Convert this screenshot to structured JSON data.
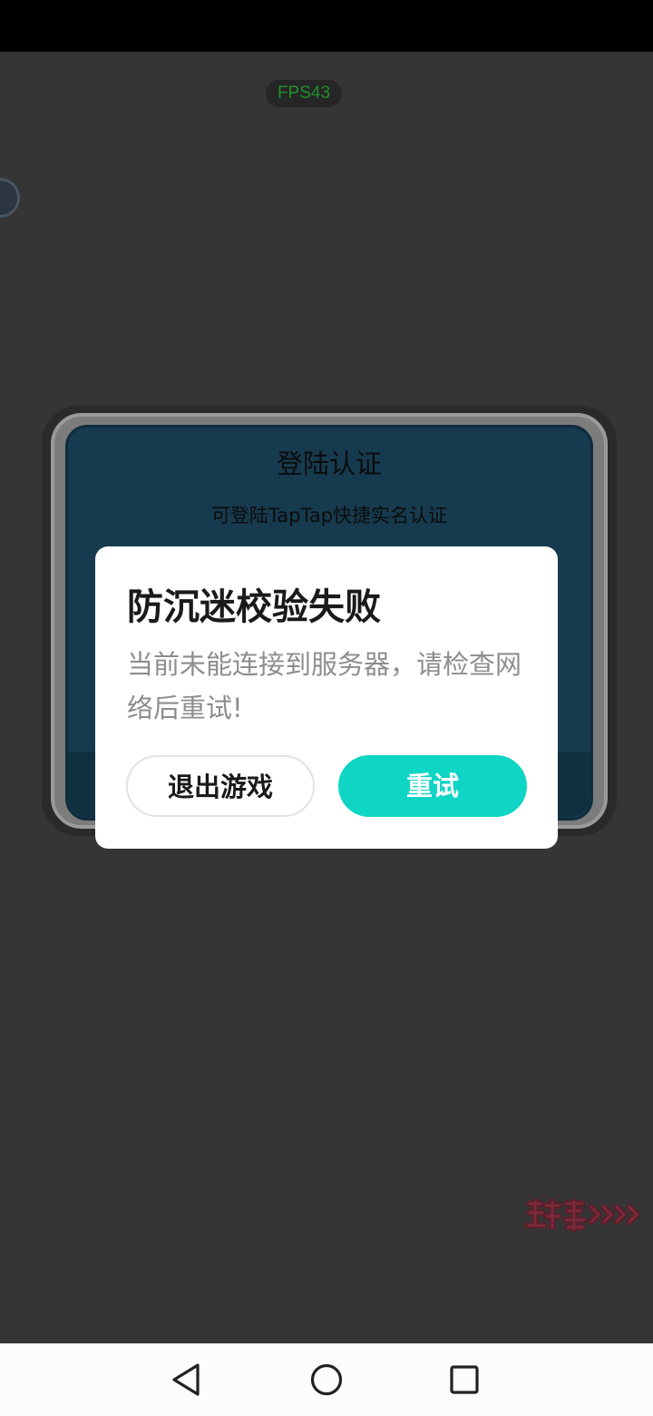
{
  "hud": {
    "fps_label": "FPS43"
  },
  "login_panel": {
    "title": "登陆认证",
    "subtitle": "可登陆TapTap快捷实名认证"
  },
  "dialog": {
    "title": "防沉迷校验失败",
    "message": "当前未能连接到服务器，请检查网络后重试!",
    "exit_button_label": "退出游戏",
    "retry_button_label": "重试"
  },
  "watermark": {
    "icon": "brand-logo"
  },
  "navigation": {
    "back_icon": "triangle-back-icon",
    "home_icon": "circle-home-icon",
    "recents_icon": "square-recents-icon"
  },
  "colors": {
    "retry_accent": "#0fd5c4",
    "fps_text": "#1f8f2a",
    "panel_blue": "#163a4e"
  }
}
